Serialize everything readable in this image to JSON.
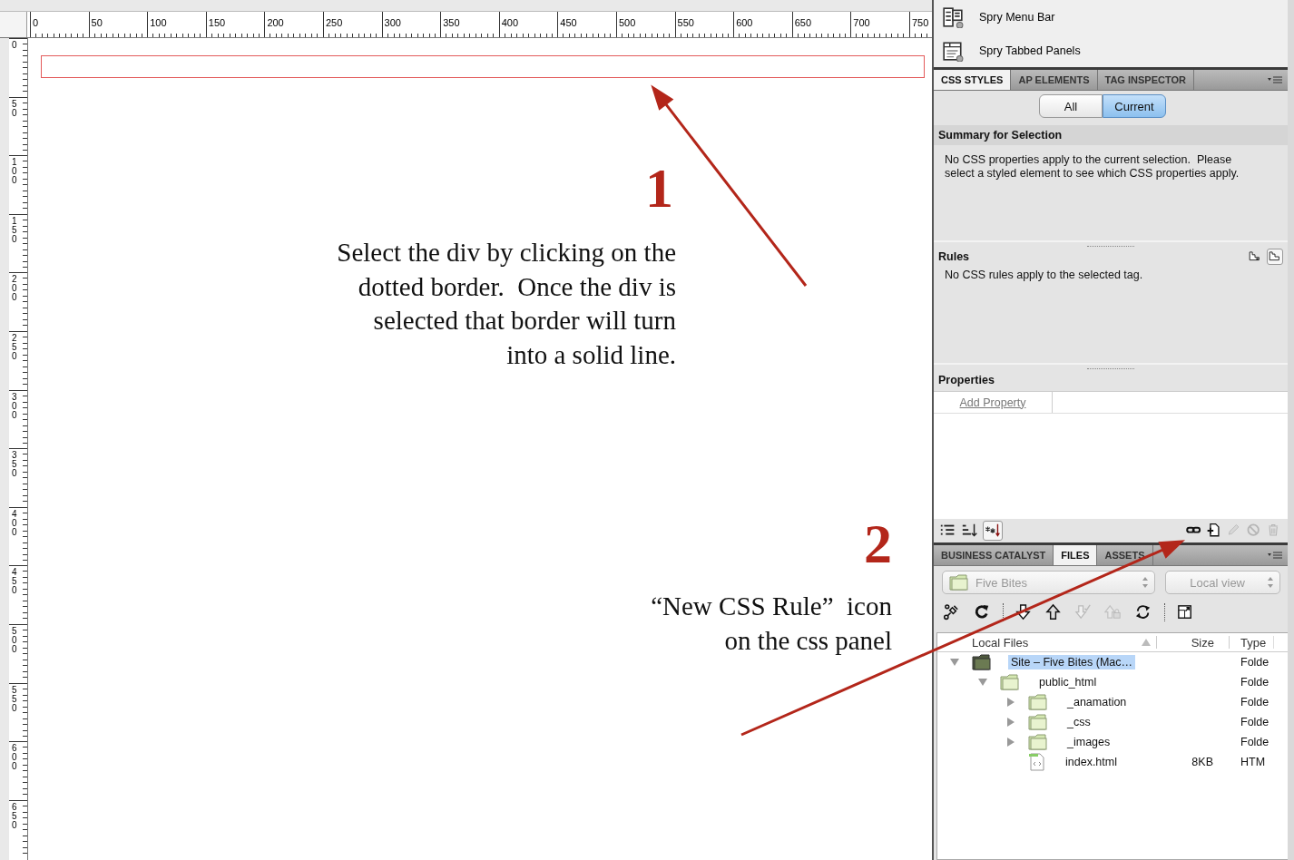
{
  "document": {
    "horizontal_ruler": [
      "0",
      "50",
      "100",
      "150",
      "200",
      "250",
      "300",
      "350",
      "400",
      "450",
      "500",
      "550",
      "600",
      "650",
      "700",
      "750"
    ],
    "vertical_ruler": [
      "0",
      "50",
      "100",
      "150",
      "200",
      "250",
      "300",
      "350",
      "400",
      "450",
      "500",
      "550",
      "600",
      "650"
    ],
    "div": {
      "selected": true
    }
  },
  "annotations": [
    {
      "number": "1",
      "lines": [
        "Select the div by clicking on the",
        "dotted border.  Once the div is",
        "selected that border will turn",
        "into a solid line."
      ]
    },
    {
      "number": "2",
      "lines": [
        "“New CSS Rule”  icon",
        "on the css panel"
      ]
    }
  ],
  "insert_panel": {
    "items": [
      {
        "kind": "menu-bar",
        "label": "Spry Menu Bar"
      },
      {
        "kind": "tabbed-panels",
        "label": "Spry Tabbed Panels"
      }
    ]
  },
  "css_panel": {
    "tabs": [
      {
        "label": "CSS STYLES",
        "selected": true
      },
      {
        "label": "AP ELEMENTS",
        "selected": false
      },
      {
        "label": "TAG INSPECTOR",
        "selected": false
      }
    ],
    "modes": [
      {
        "label": "All",
        "selected": false
      },
      {
        "label": "Current",
        "selected": true
      }
    ],
    "summary": {
      "title": "Summary for Selection",
      "lines": [
        "No CSS properties apply to the current selection.  Please",
        "select a styled element to see which CSS properties apply."
      ]
    },
    "rules": {
      "title": "Rules",
      "text": "No CSS rules apply to the selected tag.",
      "views": [
        {
          "kind": "about",
          "selected": false
        },
        {
          "kind": "cascade",
          "selected": true
        }
      ]
    },
    "properties": {
      "title": "Properties",
      "add_link": "Add Property"
    },
    "views": [
      {
        "kind": "category",
        "selected": false
      },
      {
        "kind": "alphabetical",
        "selected": false
      },
      {
        "kind": "set-only",
        "selected": true
      }
    ],
    "actions": [
      {
        "kind": "attach",
        "disabled": false
      },
      {
        "kind": "new-rule",
        "disabled": false
      },
      {
        "kind": "edit",
        "disabled": true
      },
      {
        "kind": "disable",
        "disabled": true
      },
      {
        "kind": "delete",
        "disabled": true
      }
    ]
  },
  "files_panel": {
    "tabs": [
      {
        "label": "BUSINESS CATALYST",
        "selected": false
      },
      {
        "label": "FILES",
        "selected": true
      },
      {
        "label": "ASSETS",
        "selected": false
      }
    ],
    "site": "Five Bites",
    "view": "Local view",
    "actions": [
      {
        "kind": "connect",
        "disabled": false
      },
      {
        "kind": "refresh",
        "disabled": false
      },
      {
        "kind": "get",
        "disabled": false
      },
      {
        "kind": "put",
        "disabled": false
      },
      {
        "kind": "check-out",
        "disabled": true
      },
      {
        "kind": "check-in",
        "disabled": true
      },
      {
        "kind": "sync",
        "disabled": false
      },
      {
        "kind": "expand",
        "disabled": false
      }
    ],
    "columns": [
      "Local Files",
      "Size",
      "Type"
    ],
    "tree": [
      {
        "kind": "site",
        "name": "Site – Five Bites (Mac…",
        "type": "Folde",
        "expanded": true,
        "selected": true,
        "children": [
          {
            "kind": "folder",
            "name": "public_html",
            "type": "Folde",
            "expanded": true,
            "selected": false,
            "children": [
              {
                "kind": "folder",
                "name": "_anamation",
                "type": "Folde",
                "expanded": false,
                "selected": false
              },
              {
                "kind": "folder",
                "name": "_css",
                "type": "Folde",
                "expanded": false,
                "selected": false
              },
              {
                "kind": "folder",
                "name": "_images",
                "type": "Folde",
                "expanded": false,
                "selected": false
              },
              {
                "kind": "file",
                "name": "index.html",
                "size": "8KB",
                "type": "HTM",
                "selected": false
              }
            ]
          }
        ]
      }
    ]
  }
}
